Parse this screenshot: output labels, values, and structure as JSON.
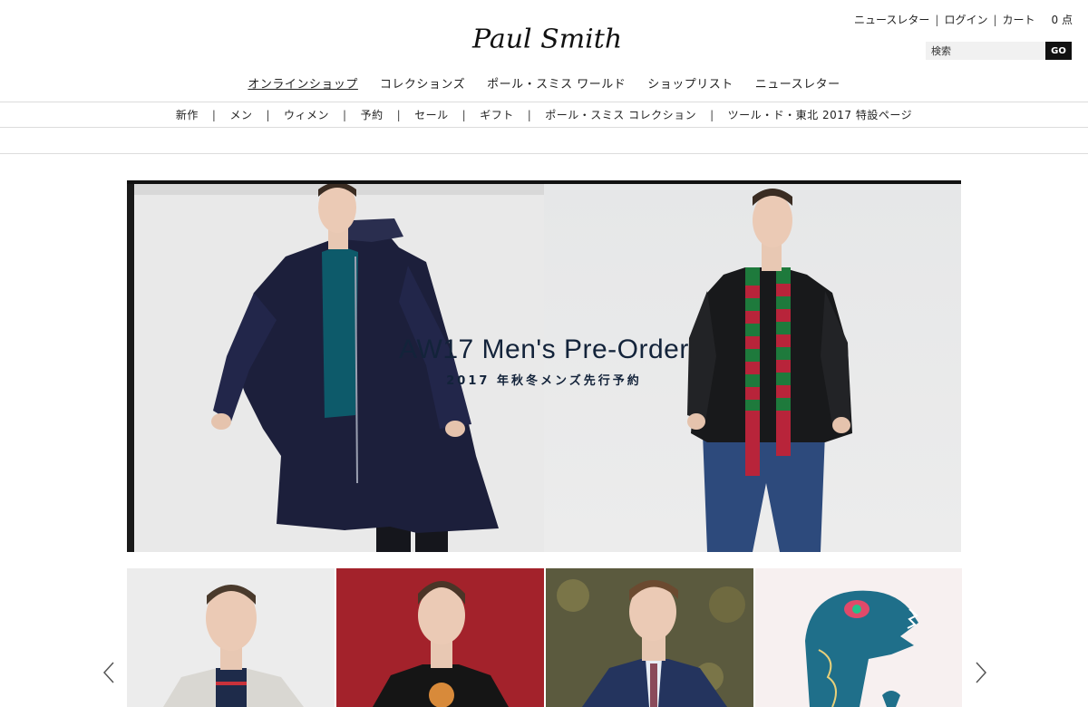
{
  "brand": {
    "logo_text": "Paul Smith"
  },
  "utility_nav": {
    "newsletter": "ニュースレター",
    "login": "ログイン",
    "cart": "カート",
    "cart_count": "0 点",
    "separator": "|"
  },
  "search": {
    "placeholder": "検索",
    "button_label": "GO"
  },
  "main_nav": {
    "items": [
      {
        "label": "オンラインショップ",
        "active": true
      },
      {
        "label": "コレクションズ"
      },
      {
        "label": "ポール・スミス ワールド"
      },
      {
        "label": "ショップリスト"
      },
      {
        "label": "ニュースレター"
      }
    ]
  },
  "sub_nav": {
    "items": [
      {
        "label": "新作"
      },
      {
        "label": "メン"
      },
      {
        "label": "ウィメン"
      },
      {
        "label": "予約"
      },
      {
        "label": "セール"
      },
      {
        "label": "ギフト"
      },
      {
        "label": "ポール・スミス コレクション"
      },
      {
        "label": "ツール・ド・東北 2017 特設ページ"
      }
    ],
    "separator": "|"
  },
  "hero": {
    "title": "AW17 Men's Pre-Order",
    "subtitle": "2017 年秋冬メンズ先行予約"
  },
  "colors": {
    "accent_dark": "#111111",
    "hero_text": "#13233a",
    "coat_navy": "#1c1f3b",
    "sweater_teal": "#0d5a6a",
    "scarf_green": "#1e7a3c",
    "scarf_red": "#b8243a",
    "dino_teal": "#1f6f8a",
    "tile_red_bg": "#a3222b"
  },
  "carousel": {
    "icons": {
      "prev": "chevron-left-icon",
      "next": "chevron-right-icon"
    }
  }
}
